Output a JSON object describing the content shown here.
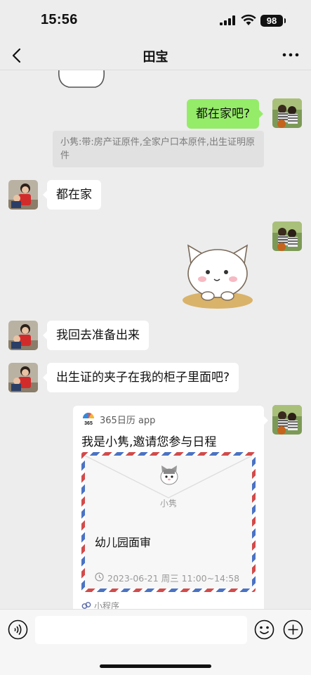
{
  "status_bar": {
    "time": "15:56",
    "battery": "98"
  },
  "header": {
    "title": "田宝"
  },
  "messages": [
    {
      "id": "m1",
      "text": "都在家吧?"
    },
    {
      "id": "m1q",
      "text": "小隽:带:房产证原件,全家户口本原件,出生证明原件"
    },
    {
      "id": "m2",
      "text": "都在家"
    },
    {
      "id": "m4",
      "text": "我回去准备出来"
    },
    {
      "id": "m5",
      "text": "出生证的夹子在我的柜子里面吧?"
    }
  ],
  "card": {
    "app_icon_text": "365",
    "app_name": "365日历 app",
    "title": "我是小隽,邀请您参与日程",
    "sender": "小隽",
    "event_name": "幼儿园面审",
    "event_time": "2023-06-21 周三 11:00~14:58",
    "footer": "小程序"
  },
  "input": {
    "placeholder": ""
  },
  "colors": {
    "background": "#ededed",
    "outgoing_bubble": "#95ec69",
    "incoming_bubble": "#ffffff"
  }
}
